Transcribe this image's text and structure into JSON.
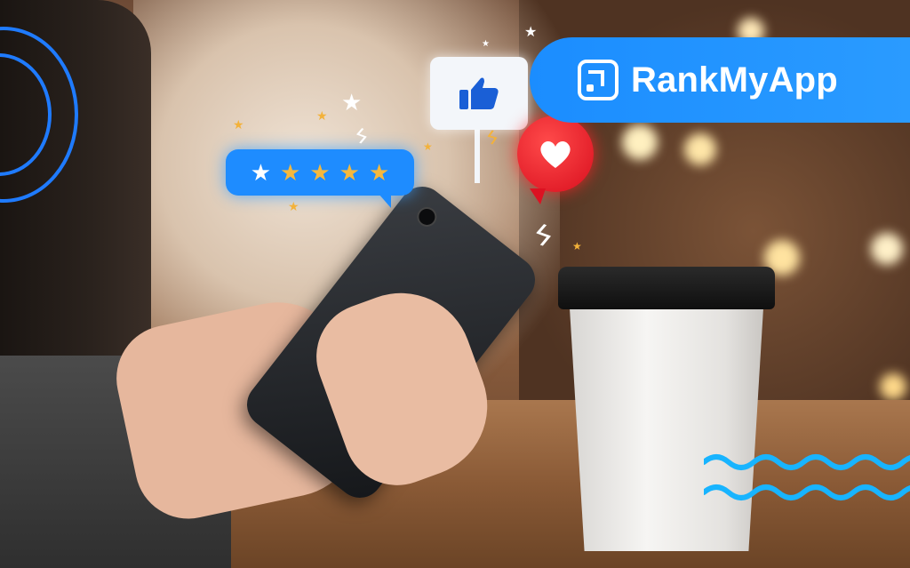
{
  "brand": {
    "name": "RankMyApp",
    "color": "#1e8cff",
    "icon": "rankmyapp-logo-icon"
  },
  "rating": {
    "stars": 5,
    "highlighted": 1,
    "star_glyph": "★",
    "star_icon": "star-icon"
  },
  "reactions": {
    "like_icon": "thumbs-up-icon",
    "love_icon": "heart-icon"
  },
  "decor": {
    "wave_color": "#18b4ff",
    "ring_color": "#1f7bff",
    "heart_color": "#e21a24"
  }
}
